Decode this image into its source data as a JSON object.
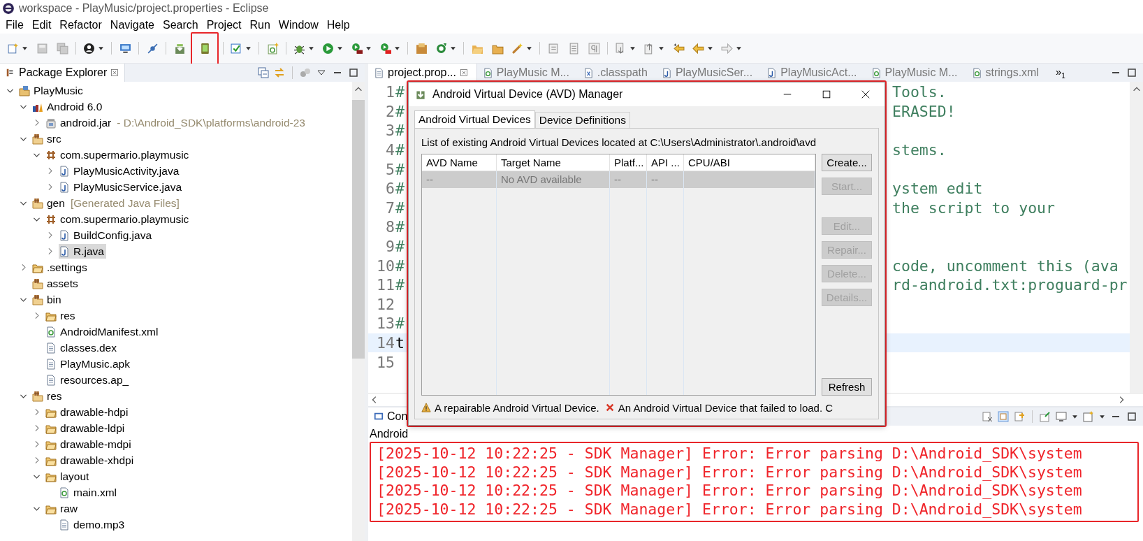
{
  "window": {
    "title": "workspace - PlayMusic/project.properties - Eclipse"
  },
  "menu": [
    "File",
    "Edit",
    "Refactor",
    "Navigate",
    "Search",
    "Project",
    "Run",
    "Window",
    "Help"
  ],
  "toolbar": [
    {
      "kind": "new",
      "dropdown": true,
      "highlighted": false
    },
    {
      "kind": "save",
      "dropdown": false,
      "highlighted": false
    },
    {
      "kind": "save-all",
      "dropdown": false,
      "highlighted": false
    },
    {
      "kind": "separator"
    },
    {
      "kind": "account",
      "dropdown": true,
      "highlighted": false
    },
    {
      "kind": "separator"
    },
    {
      "kind": "monitor",
      "dropdown": false,
      "highlighted": false
    },
    {
      "kind": "separator"
    },
    {
      "kind": "skip-breakpoints",
      "dropdown": false,
      "highlighted": false
    },
    {
      "kind": "separator"
    },
    {
      "kind": "sdk-download",
      "dropdown": false,
      "highlighted": false
    },
    {
      "kind": "device",
      "dropdown": false,
      "highlighted": true
    },
    {
      "kind": "separator"
    },
    {
      "kind": "checklist",
      "dropdown": true,
      "highlighted": false
    },
    {
      "kind": "separator"
    },
    {
      "kind": "new-class",
      "dropdown": false,
      "highlighted": false
    },
    {
      "kind": "separator"
    },
    {
      "kind": "bug",
      "dropdown": true,
      "highlighted": false
    },
    {
      "kind": "run",
      "dropdown": true,
      "highlighted": false
    },
    {
      "kind": "run-tool",
      "dropdown": true,
      "highlighted": false
    },
    {
      "kind": "run-stop",
      "dropdown": true,
      "highlighted": false
    },
    {
      "kind": "separator"
    },
    {
      "kind": "open-type",
      "dropdown": false,
      "highlighted": false
    },
    {
      "kind": "refresh",
      "dropdown": true,
      "highlighted": false
    },
    {
      "kind": "separator"
    },
    {
      "kind": "open-folder",
      "dropdown": false,
      "highlighted": false
    },
    {
      "kind": "folder",
      "dropdown": false,
      "highlighted": false
    },
    {
      "kind": "wand",
      "dropdown": true,
      "highlighted": false
    },
    {
      "kind": "separator"
    },
    {
      "kind": "toggle-block",
      "dropdown": false,
      "highlighted": false
    },
    {
      "kind": "document",
      "dropdown": false,
      "highlighted": false
    },
    {
      "kind": "pilcrow",
      "dropdown": false,
      "highlighted": false
    },
    {
      "kind": "separator"
    },
    {
      "kind": "next-annotation",
      "dropdown": true,
      "highlighted": false
    },
    {
      "kind": "prev-annotation",
      "dropdown": true,
      "highlighted": false
    },
    {
      "kind": "last-edit",
      "dropdown": false,
      "highlighted": false
    },
    {
      "kind": "back",
      "dropdown": true,
      "highlighted": false
    },
    {
      "kind": "forward",
      "dropdown": true,
      "highlighted": false
    }
  ],
  "package_explorer": {
    "title": "Package Explorer",
    "tree": [
      {
        "label": "PlayMusic",
        "kind": "project",
        "expanded": true,
        "selected": false,
        "children": [
          {
            "label": "Android 6.0",
            "kind": "library",
            "expanded": true,
            "selected": false,
            "children": [
              {
                "label": "android.jar",
                "decoration": "- D:\\Android_SDK\\platforms\\android-23",
                "kind": "jar",
                "expanded": false,
                "selected": false
              }
            ]
          },
          {
            "label": "src",
            "kind": "source-folder",
            "expanded": true,
            "selected": false,
            "children": [
              {
                "label": "com.supermario.playmusic",
                "kind": "package",
                "expanded": true,
                "selected": false,
                "children": [
                  {
                    "label": "PlayMusicActivity.java",
                    "kind": "java",
                    "expanded": false,
                    "selected": false
                  },
                  {
                    "label": "PlayMusicService.java",
                    "kind": "java",
                    "expanded": false,
                    "selected": false
                  }
                ]
              }
            ]
          },
          {
            "label": "gen",
            "decoration": "[Generated Java Files]",
            "kind": "source-folder",
            "expanded": true,
            "selected": false,
            "children": [
              {
                "label": "com.supermario.playmusic",
                "kind": "package",
                "expanded": true,
                "selected": false,
                "children": [
                  {
                    "label": "BuildConfig.java",
                    "kind": "java",
                    "expanded": false,
                    "selected": false
                  },
                  {
                    "label": "R.java",
                    "kind": "java",
                    "expanded": false,
                    "selected": true
                  }
                ]
              }
            ]
          },
          {
            "label": ".settings",
            "kind": "folder",
            "expanded": false,
            "selected": false
          },
          {
            "label": "assets",
            "kind": "source-folder",
            "selected": false
          },
          {
            "label": "bin",
            "kind": "source-folder",
            "expanded": true,
            "selected": false,
            "children": [
              {
                "label": "res",
                "kind": "folder",
                "expanded": false,
                "selected": false
              },
              {
                "label": "AndroidManifest.xml",
                "kind": "xml",
                "selected": false
              },
              {
                "label": "classes.dex",
                "kind": "file",
                "selected": false
              },
              {
                "label": "PlayMusic.apk",
                "kind": "file",
                "selected": false
              },
              {
                "label": "resources.ap_",
                "kind": "file",
                "selected": false
              }
            ]
          },
          {
            "label": "res",
            "kind": "source-folder",
            "expanded": true,
            "selected": false,
            "children": [
              {
                "label": "drawable-hdpi",
                "kind": "folder",
                "expanded": false,
                "selected": false
              },
              {
                "label": "drawable-ldpi",
                "kind": "folder",
                "expanded": false,
                "selected": false
              },
              {
                "label": "drawable-mdpi",
                "kind": "folder",
                "expanded": false,
                "selected": false
              },
              {
                "label": "drawable-xhdpi",
                "kind": "folder",
                "expanded": false,
                "selected": false
              },
              {
                "label": "layout",
                "kind": "folder",
                "expanded": true,
                "selected": false,
                "children": [
                  {
                    "label": "main.xml",
                    "kind": "xml",
                    "selected": false
                  }
                ]
              },
              {
                "label": "raw",
                "kind": "folder",
                "expanded": true,
                "selected": false,
                "children": [
                  {
                    "label": "demo.mp3",
                    "kind": "file",
                    "selected": false
                  }
                ]
              }
            ]
          }
        ]
      }
    ]
  },
  "editor": {
    "tabs": [
      {
        "label": "project.prop...",
        "kind": "file",
        "selected": true
      },
      {
        "label": "PlayMusic M...",
        "kind": "xml",
        "selected": false
      },
      {
        "label": ".classpath",
        "kind": "xfile",
        "selected": false
      },
      {
        "label": "PlayMusicSer...",
        "kind": "java",
        "selected": false
      },
      {
        "label": "PlayMusicAct...",
        "kind": "java",
        "selected": false
      },
      {
        "label": "PlayMusic M...",
        "kind": "xml",
        "selected": false
      },
      {
        "label": "strings.xml",
        "kind": "xml",
        "selected": false
      }
    ],
    "overflow": "»$_{1}$",
    "lines": [
      {
        "number": "1",
        "prefix": "#",
        "tail": "Tools.",
        "current": false
      },
      {
        "number": "2",
        "prefix": "#",
        "tail": "ERASED!",
        "current": false
      },
      {
        "number": "3",
        "prefix": "#",
        "current": false
      },
      {
        "number": "4",
        "prefix": "#",
        "tail": "stems.",
        "current": false
      },
      {
        "number": "5",
        "prefix": "#",
        "current": false
      },
      {
        "number": "6",
        "prefix": "#",
        "tail": "ystem edit",
        "current": false
      },
      {
        "number": "7",
        "prefix": "#",
        "tail": "the script to your",
        "current": false
      },
      {
        "number": "8",
        "prefix": "#",
        "current": false
      },
      {
        "number": "9",
        "prefix": "#",
        "current": false
      },
      {
        "number": "10",
        "prefix": "#",
        "tail": "code, uncomment this (ava",
        "current": false
      },
      {
        "number": "11",
        "prefix": "#",
        "tail": "rd-android.txt:proguard-pr",
        "current": false
      },
      {
        "number": "12",
        "current": false
      },
      {
        "number": "13",
        "prefix": "#",
        "current": false
      },
      {
        "number": "14",
        "prefix": "t",
        "current": true
      },
      {
        "number": "15",
        "current": false
      }
    ]
  },
  "console": {
    "tab": "Con",
    "label": "Android",
    "highlighted": true,
    "lines": [
      {
        "text": "[2025-10-12 10:22:25 - SDK Manager] Error: Error parsing D:\\Android_SDK\\system",
        "kind": "error"
      },
      {
        "text": "[2025-10-12 10:22:25 - SDK Manager] Error: Error parsing D:\\Android_SDK\\system",
        "kind": "error"
      },
      {
        "text": "[2025-10-12 10:22:25 - SDK Manager] Error: Error parsing D:\\Android_SDK\\system",
        "kind": "error"
      },
      {
        "text": "[2025-10-12 10:22:25 - SDK Manager] Error: Error parsing D:\\Android_SDK\\system",
        "kind": "error"
      }
    ]
  },
  "avd_dialog": {
    "title": "Android Virtual Device (AVD) Manager",
    "highlighted": true,
    "tabs": [
      {
        "label": "Android Virtual Devices",
        "selected": true
      },
      {
        "label": "Device Definitions",
        "selected": false
      }
    ],
    "location": "List of existing Android Virtual Devices located at C:\\Users\\Administrator\\.android\\avd",
    "columns": [
      "AVD Name",
      "Target Name",
      "Platf...",
      "API ...",
      "CPU/ABI"
    ],
    "rows": [
      {
        "cells": [
          "--",
          "No AVD available",
          "--",
          "--"
        ],
        "selected": true
      }
    ],
    "button_groups": [
      [
        {
          "label": "Create...",
          "disabled": false
        },
        {
          "label": "Start...",
          "disabled": true
        }
      ],
      [
        {
          "label": "Edit...",
          "disabled": true
        },
        {
          "label": "Repair...",
          "disabled": true
        },
        {
          "label": "Delete...",
          "disabled": true
        },
        {
          "label": "Details...",
          "disabled": true
        }
      ],
      [
        {
          "label": "Refresh",
          "disabled": false
        }
      ]
    ],
    "legend": [
      {
        "kind": "warning",
        "text": "A repairable Android Virtual Device."
      },
      {
        "kind": "error",
        "text": "An Android Virtual Device that failed to load. C"
      }
    ]
  }
}
